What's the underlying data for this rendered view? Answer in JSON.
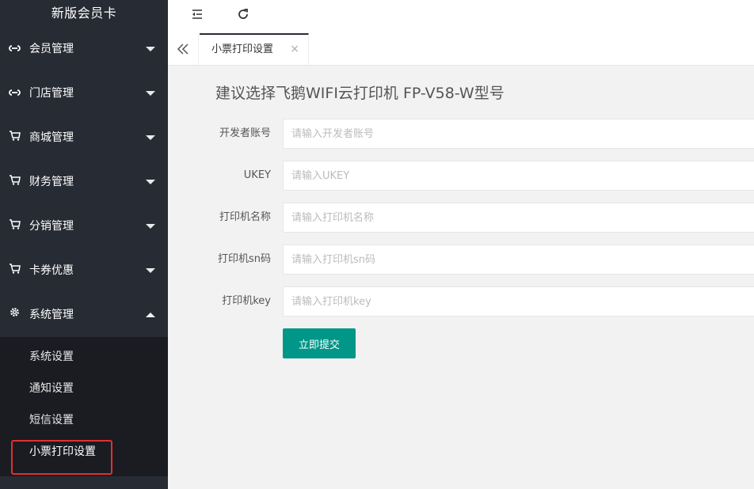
{
  "app": {
    "title": "新版会员卡"
  },
  "sidebar": {
    "items": [
      {
        "label": "会员管理",
        "icon": "link-icon"
      },
      {
        "label": "门店管理",
        "icon": "link-icon"
      },
      {
        "label": "商城管理",
        "icon": "cart-icon"
      },
      {
        "label": "财务管理",
        "icon": "cart-icon"
      },
      {
        "label": "分销管理",
        "icon": "cart-icon"
      },
      {
        "label": "卡券优惠",
        "icon": "cart-icon"
      },
      {
        "label": "系统管理",
        "icon": "gear-icon",
        "expanded": true
      }
    ],
    "submenu": [
      {
        "label": "系统设置"
      },
      {
        "label": "通知设置"
      },
      {
        "label": "短信设置"
      },
      {
        "label": "小票打印设置",
        "active": true
      }
    ]
  },
  "header": {
    "buttons": [
      "menu-fold-icon",
      "refresh-icon"
    ]
  },
  "tabs": [
    {
      "label": "小票打印设置",
      "close": "×"
    }
  ],
  "main": {
    "title": "建议选择飞鹅WIFI云打印机 FP-V58-W型号",
    "fields": [
      {
        "label": "开发者账号",
        "placeholder": "请输入开发者账号",
        "value": ""
      },
      {
        "label": "UKEY",
        "placeholder": "请输入UKEY",
        "value": ""
      },
      {
        "label": "打印机名称",
        "placeholder": "请输入打印机名称",
        "value": ""
      },
      {
        "label": "打印机sn码",
        "placeholder": "请输入打印机sn码",
        "value": ""
      },
      {
        "label": "打印机key",
        "placeholder": "请输入打印机key",
        "value": ""
      }
    ],
    "submit_label": "立即提交"
  },
  "colors": {
    "sidebar_bg": "#272b34",
    "submenu_bg": "#1a1c22",
    "primary": "#009688",
    "highlight": "#e0312e"
  }
}
